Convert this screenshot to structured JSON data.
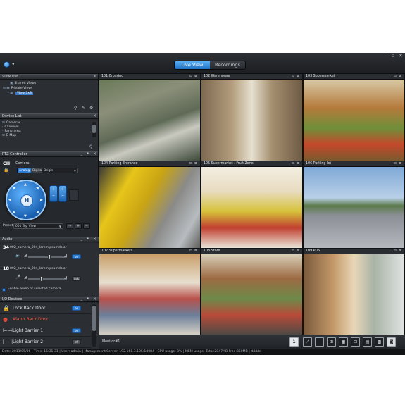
{
  "app": {
    "tabs": [
      {
        "label": "Live View",
        "active": true
      },
      {
        "label": "Recordings",
        "active": false
      }
    ],
    "accent_color": "#2d7bd0"
  },
  "view_list": {
    "title": "View List",
    "items": [
      {
        "label": "Shared Views"
      },
      {
        "label": "Private Views"
      },
      {
        "label": "View 3x3",
        "selected": true
      }
    ]
  },
  "device_list": {
    "title": "Device List",
    "items": [
      {
        "label": "Cameras"
      },
      {
        "label": "Carousel"
      },
      {
        "label": "Panorama"
      },
      {
        "label": "E-Map"
      }
    ]
  },
  "ptz": {
    "title": "PTZ Controller",
    "channel": "CH",
    "camera_label": "Camera",
    "modes": [
      "Analog",
      "Digital"
    ],
    "active_mode": "Analog",
    "origin_value": "Origin",
    "preset_label": "Preset",
    "preset_value": "001 Top View"
  },
  "audio": {
    "title": "Audio",
    "channels": [
      {
        "num": "34",
        "name": "002_camera_004_loremipsumdolor",
        "toggle": "on",
        "level": 0.55
      },
      {
        "num": "18",
        "name": "002_camera_004_loremipsumdolor",
        "toggle": "talk",
        "level": 0.35
      }
    ],
    "enable_label": "Enable audio of selected camera"
  },
  "io_devices": {
    "title": "I/O Devices",
    "items": [
      {
        "label": "Lock Back Door",
        "icon": "lock-icon",
        "alarm": false,
        "toggle": "on"
      },
      {
        "label": "Alarm Back Door",
        "icon": "alarm-icon",
        "alarm": true,
        "toggle": ""
      },
      {
        "label": "Light Barrier 1",
        "icon": "light-barrier-icon",
        "alarm": false,
        "toggle": "on"
      },
      {
        "label": "Light Barrier 2",
        "icon": "light-barrier-icon",
        "alarm": false,
        "toggle": "off"
      }
    ]
  },
  "cameras": [
    {
      "title": "101 Crossing"
    },
    {
      "title": "102 Warehouse"
    },
    {
      "title": "103 Supermarket"
    },
    {
      "title": "104 Parking Entrance"
    },
    {
      "title": "105 Supermarket : Fruit Zone"
    },
    {
      "title": "106 Parking lot"
    },
    {
      "title": "107 Supermarkets"
    },
    {
      "title": "108 Store"
    },
    {
      "title": "109 POS"
    }
  ],
  "layout_bar": {
    "monitor_label": "Monitor#1",
    "layout_number": "1"
  },
  "status": {
    "text": "Date: 2011/05/06  |  Time: 15:31:31  |  User: admin  |  Management Server: 192.168.3.105:18084  |  CPU usage: 3%  |  MEM usage: Total:2047MB  Free:850MB  |  ddddd"
  }
}
